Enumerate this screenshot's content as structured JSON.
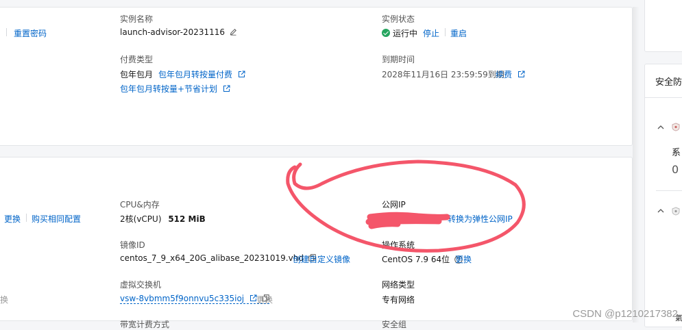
{
  "top": {
    "reset_password": "重置密码",
    "instance_name_label": "实例名称",
    "instance_name": "launch-advisor-20231116",
    "instance_status_label": "实例状态",
    "status_running": "运行中",
    "stop": "停止",
    "restart": "重启",
    "billing_type_label": "付费类型",
    "billing_type": "包年包月",
    "switch_to_payg": "包年包月转按量付费",
    "switch_to_payg_saving": "包年包月转按量+节省计划",
    "expire_label": "到期时间",
    "expire_time": "2028年11月16日 23:59:59到期",
    "renew": "续费"
  },
  "bottom": {
    "change": "更换",
    "buy_same": "购买相同配置",
    "cpu_mem_label": "CPU&内存",
    "cpu_value": "2核(vCPU)",
    "mem_value": "512 MiB",
    "public_ip_label": "公网IP",
    "convert_eip": "转换为弹性公网IP",
    "image_id_label": "镜像ID",
    "image_id": "centos_7_9_x64_20G_alibase_20231019.vhd",
    "create_image": "创建自定义镜像",
    "os_label": "操作系统",
    "os_value": "CentOS 7.9 64位",
    "os_change": "更换",
    "vswitch_label": "虚拟交换机",
    "vswitch": "vsw-8vbmm5f9onnvu5c335ioj",
    "vswitch_change": "更换",
    "left_change_partial": "换",
    "network_type_label": "网络类型",
    "network_type": "专有网络",
    "bottom_cut_label_1": "带宽计费方式",
    "bottom_cut_label_2": "安全组"
  },
  "sidebar": {
    "security_title": "安全防",
    "partial_text_1": "系",
    "partial_num": "0",
    "partial_text_2": "氣"
  },
  "watermark": "CSDN @p1210217382",
  "colors": {
    "link": "#0064c8",
    "running": "#25a55f",
    "annotation": "#f4566a"
  }
}
